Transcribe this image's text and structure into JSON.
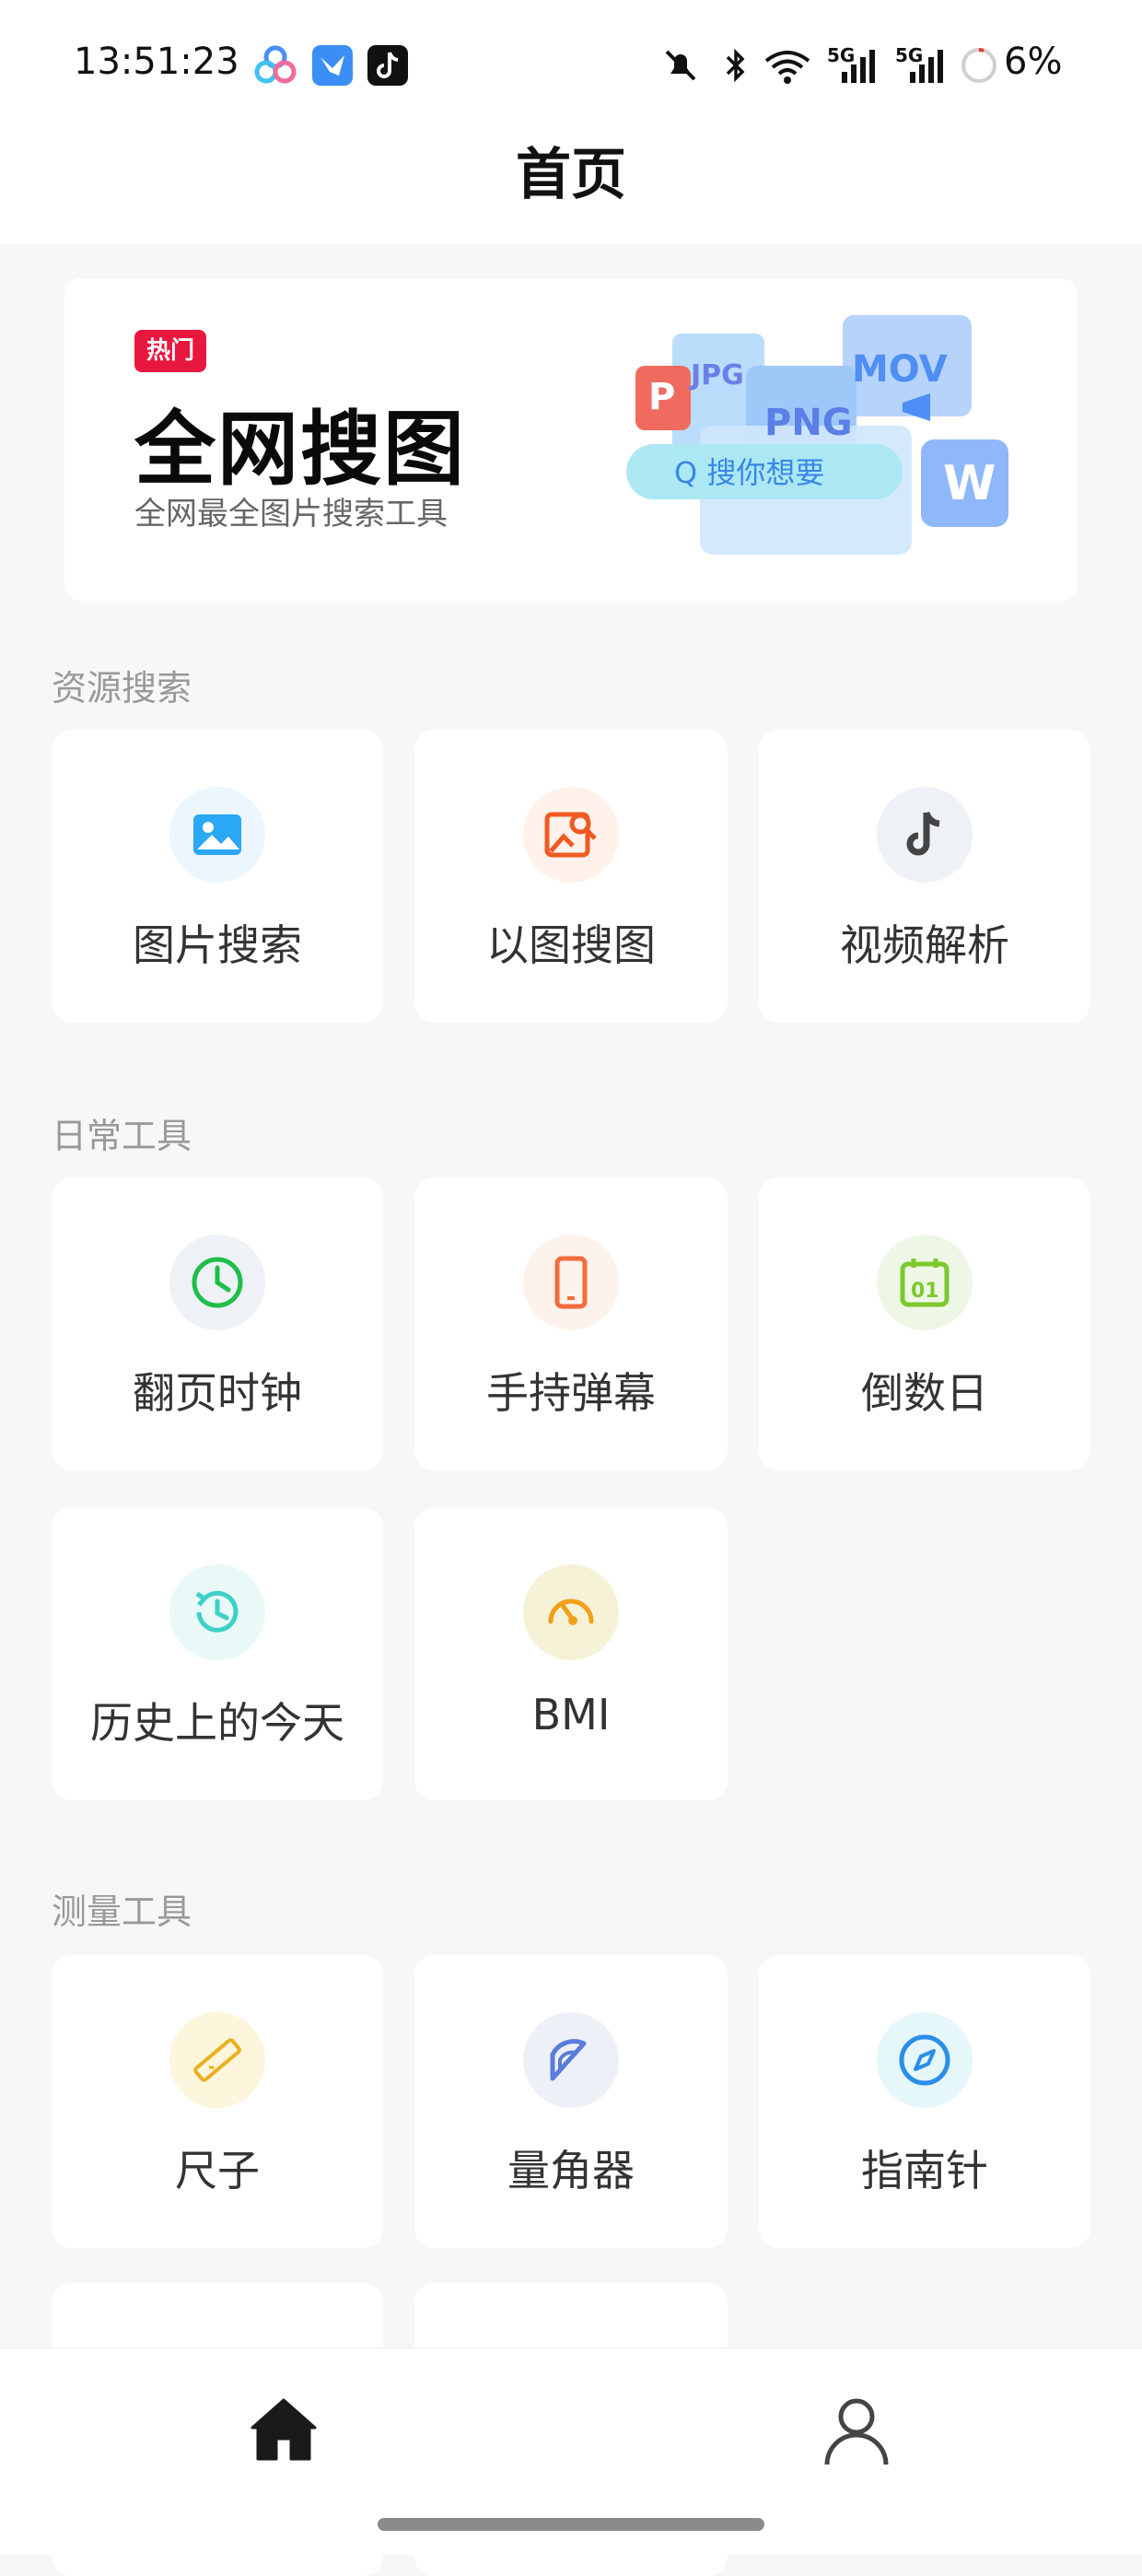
{
  "status_bar": {
    "time": "13:51:23",
    "battery": "6%",
    "signal_1": "5G",
    "signal_2": "5G"
  },
  "header": {
    "title": "首页"
  },
  "banner": {
    "badge": "热门",
    "title": "全网搜图",
    "subtitle": "全网最全图片搜索工具",
    "art": {
      "tags": [
        "P",
        "JPG",
        "PNG",
        "MOV",
        "W"
      ],
      "search_text": "Q 搜你想要"
    }
  },
  "sections": [
    {
      "title": "资源搜索",
      "items": [
        {
          "label": "图片搜索",
          "icon": "image-icon",
          "color": "#2aa7f5",
          "bg": "#ecf6fe"
        },
        {
          "label": "以图搜图",
          "icon": "image-search-icon",
          "color": "#f05a22",
          "bg": "#fef2ea"
        },
        {
          "label": "视频解析",
          "icon": "tiktok-icon",
          "color": "#444444",
          "bg": "#eef1f6"
        }
      ]
    },
    {
      "title": "日常工具",
      "items": [
        {
          "label": "翻页时钟",
          "icon": "clock-icon",
          "color": "#1fbe4b",
          "bg": "#eef1f6"
        },
        {
          "label": "手持弹幕",
          "icon": "phone-icon",
          "color": "#f36b3c",
          "bg": "#fef3ec"
        },
        {
          "label": "倒数日",
          "icon": "calendar-icon",
          "color": "#7bc92d",
          "bg": "#eef7e6"
        },
        {
          "label": "历史上的今天",
          "icon": "history-icon",
          "color": "#3dd1c6",
          "bg": "#e8f9f8"
        },
        {
          "label": "BMI",
          "icon": "gauge-icon",
          "color": "#f2a01a",
          "bg": "#f6f2d8"
        }
      ]
    },
    {
      "title": "测量工具",
      "items": [
        {
          "label": "尺子",
          "icon": "ruler-icon",
          "color": "#eab11f",
          "bg": "#fdf6dc"
        },
        {
          "label": "量角器",
          "icon": "protractor-icon",
          "color": "#5b7cdc",
          "bg": "#eef0f8"
        },
        {
          "label": "指南针",
          "icon": "compass-icon",
          "color": "#2b8ee8",
          "bg": "#e6f7fa"
        }
      ]
    }
  ],
  "bottom_nav": {
    "items": [
      {
        "name": "home",
        "icon": "home-icon",
        "active": true
      },
      {
        "name": "profile",
        "icon": "profile-icon",
        "active": false
      }
    ]
  }
}
